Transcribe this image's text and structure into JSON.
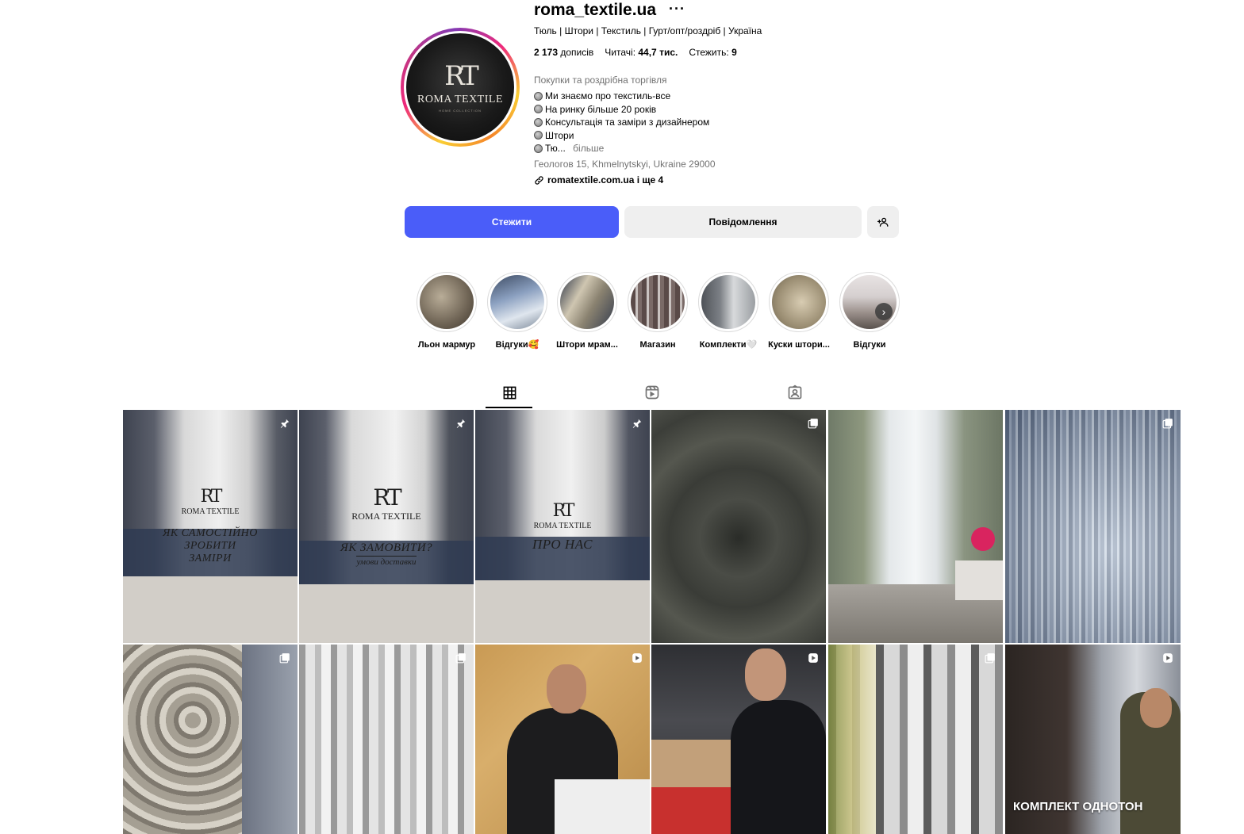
{
  "profile": {
    "username": "roma_textile.ua",
    "more_glyph": "···",
    "category_line": "Тюль | Штори | Текстиль | Гурт/опт/роздріб | Україна",
    "stats": {
      "posts_value": "2 173",
      "posts_label": "дописів",
      "followers_label": "Читачі:",
      "followers_value": "44,7 тис.",
      "following_label": "Стежить:",
      "following_value": "9"
    },
    "business_category": "Покупки та роздрібна торгівля",
    "bio_lines": [
      "Ми знаємо про текстиль-все",
      "На ринку більше 20 років",
      "Консультація та заміри з дизайнером",
      "Штори",
      "Тю..."
    ],
    "bio_more": "більше",
    "address": "Геологов 15, Khmelnytskyi, Ukraine 29000",
    "link_text": "romatextile.com.ua і ще 4",
    "avatar": {
      "monogram": "RT",
      "brand": "ROMA TEXTILE",
      "tagline": "HOME COLLECTION"
    }
  },
  "actions": {
    "follow_label": "Стежити",
    "message_label": "Повідомлення",
    "add_icon": "person-plus-icon"
  },
  "highlights": [
    {
      "label": "Льон мармур",
      "color": "#8a7e6e"
    },
    {
      "label": "Відгуки🥰",
      "color": "#6f7f96"
    },
    {
      "label": "Штори мрам...",
      "color": "#9c9383"
    },
    {
      "label": "Магазин",
      "color": "#6b5e5a"
    },
    {
      "label": "Комплекти🤍",
      "color": "#7b7f85"
    },
    {
      "label": "Куски штори...",
      "color": "#a89f8b"
    },
    {
      "label": "Відгуки",
      "color": "#8c8c8c"
    }
  ],
  "tabs": [
    {
      "name": "posts",
      "icon": "grid-icon",
      "active": true
    },
    {
      "name": "reels",
      "icon": "reels-icon",
      "active": false
    },
    {
      "name": "tagged",
      "icon": "tagged-icon",
      "active": false
    }
  ],
  "posts": [
    {
      "type": "pinned",
      "text": "ЯК САМОСТІЙНО ЗРОБИТИ ЗАМІРИ",
      "brand": "ROMA TEXTILE",
      "monogram": "RT"
    },
    {
      "type": "pinned",
      "text": "ЯК ЗАМОВИТИ?",
      "sub": "умови доставки",
      "brand": "ROMA TEXTILE",
      "monogram": "RT"
    },
    {
      "type": "pinned",
      "text": "ПРО НАС",
      "brand": "ROMA TEXTILE",
      "monogram": "RT"
    },
    {
      "type": "carousel"
    },
    {
      "type": "none"
    },
    {
      "type": "carousel"
    },
    {
      "type": "carousel"
    },
    {
      "type": "carousel"
    },
    {
      "type": "reel"
    },
    {
      "type": "reel"
    },
    {
      "type": "carousel"
    },
    {
      "type": "reel",
      "caption": "КОМПЛЕКТ ОДНОТОН"
    }
  ]
}
